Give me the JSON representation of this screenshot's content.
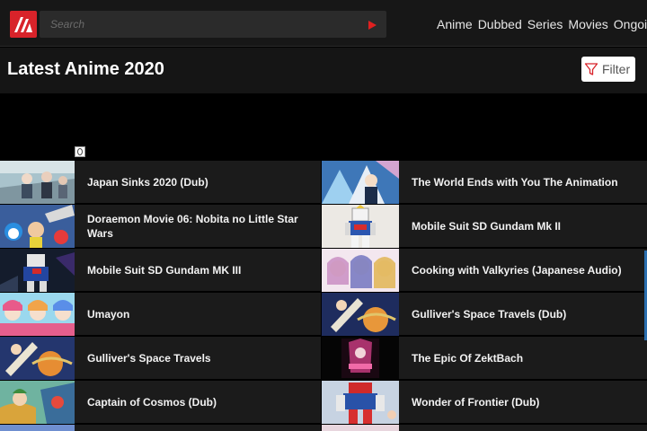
{
  "header": {
    "search_placeholder": "Search",
    "nav": [
      "Anime",
      "Dubbed",
      "Series",
      "Movies",
      "Ongoing"
    ]
  },
  "page": {
    "title": "Latest Anime 2020",
    "filter_label": "Filter"
  },
  "colors": {
    "brand": "#d8232a",
    "header_bg": "#171717",
    "row_bg": "#1b1b1b"
  },
  "icons": {
    "logo": "site-logo-icon",
    "search_submit": "play-triangle-icon",
    "filter": "funnel-icon",
    "ad_info": "info-icon"
  },
  "anime_list": {
    "left": [
      "Japan Sinks 2020 (Dub)",
      "Doraemon Movie 06: Nobita no Little Star Wars",
      "Mobile Suit SD Gundam MK III",
      "Umayon",
      "Gulliver's Space Travels",
      "Captain of Cosmos (Dub)"
    ],
    "right": [
      "The World Ends with You The Animation",
      "Mobile Suit SD Gundam Mk II",
      "Cooking with Valkyries (Japanese Audio)",
      "Gulliver's Space Travels (Dub)",
      "The Epic Of ZektBach",
      "Wonder of Frontier (Dub)"
    ]
  }
}
